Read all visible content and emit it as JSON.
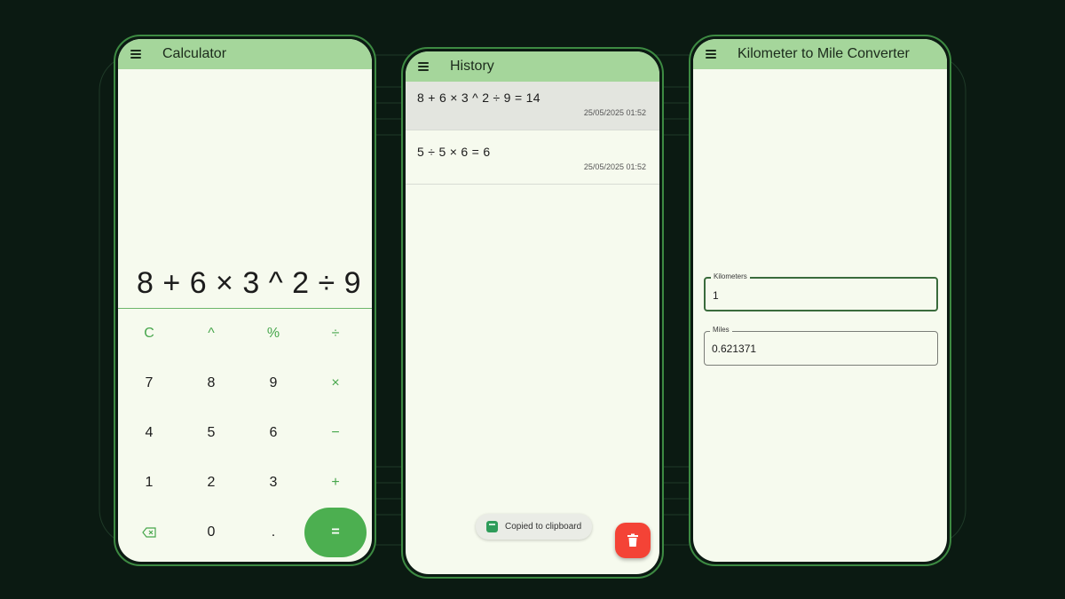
{
  "colors": {
    "background": "#0b1a12",
    "app_bar": "#a5d69b",
    "accent": "#4caf50",
    "screen": "#f6faee",
    "delete": "#f44336"
  },
  "calculator": {
    "title": "Calculator",
    "menu_icon": "menu-icon",
    "expression": "8 + 6 × 3 ^ 2 ÷ 9",
    "keys": {
      "clear": "C",
      "power": "^",
      "percent": "%",
      "divide": "÷",
      "seven": "7",
      "eight": "8",
      "nine": "9",
      "multiply": "×",
      "four": "4",
      "five": "5",
      "six": "6",
      "minus": "−",
      "one": "1",
      "two": "2",
      "three": "3",
      "plus": "+",
      "backspace_icon": "backspace-icon",
      "zero": "0",
      "dot": ".",
      "equals": "="
    }
  },
  "history": {
    "title": "History",
    "menu_icon": "menu-icon",
    "items": [
      {
        "expression": "8 + 6 × 3 ^ 2 ÷ 9 = 14",
        "timestamp": "25/05/2025 01:52"
      },
      {
        "expression": "5 ÷ 5 × 6 = 6",
        "timestamp": "25/05/2025 01:52"
      }
    ],
    "toast": {
      "text": "Copied to clipboard",
      "icon": "app-icon"
    },
    "fab_icon": "trash-icon"
  },
  "converter": {
    "title": "Kilometer to Mile Converter",
    "menu_icon": "menu-icon",
    "kilometers": {
      "label": "Kilometers",
      "value": "1"
    },
    "miles": {
      "label": "Miles",
      "value": "0.621371"
    }
  }
}
